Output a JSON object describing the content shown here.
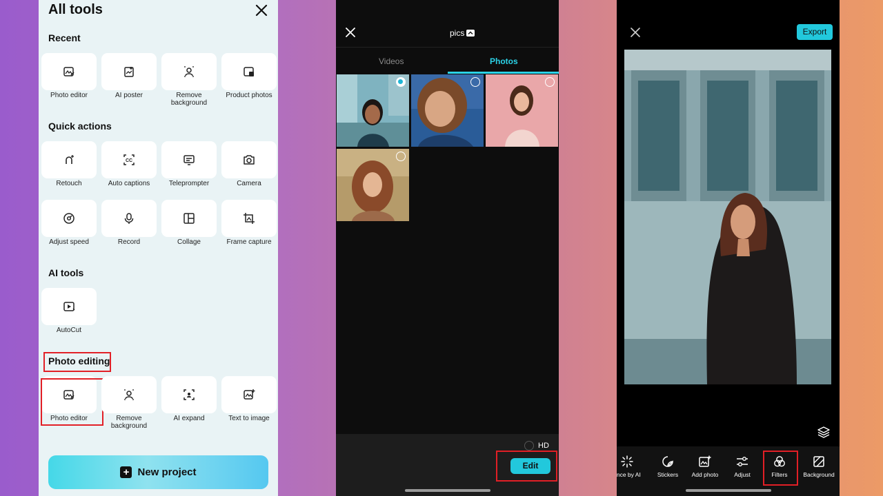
{
  "panel1": {
    "title": "All tools",
    "sections": {
      "recent": "Recent",
      "quick_actions": "Quick actions",
      "ai_tools": "AI tools",
      "photo_editing": "Photo editing"
    },
    "recent": [
      "Photo editor",
      "AI poster",
      "Remove background",
      "Product photos"
    ],
    "quick_actions_row1": [
      "Retouch",
      "Auto captions",
      "Teleprompter",
      "Camera"
    ],
    "quick_actions_row2": [
      "Adjust speed",
      "Record",
      "Collage",
      "Frame capture"
    ],
    "ai_tools": [
      "AutoCut"
    ],
    "photo_editing": [
      "Photo editor",
      "Remove background",
      "AI expand",
      "Text to image"
    ],
    "new_project": "New project"
  },
  "panel2": {
    "folder": "pics",
    "tabs": [
      "Videos",
      "Photos"
    ],
    "active_tab": "Photos",
    "hd_label": "HD",
    "edit_label": "Edit"
  },
  "panel3": {
    "export_label": "Export",
    "tools": [
      "ance by AI",
      "Stickers",
      "Add photo",
      "Adjust",
      "Filters",
      "Background"
    ]
  },
  "colors": {
    "accent": "#22c8dc",
    "highlight": "#e21f26",
    "panel1_bg": "#e9f3f5"
  }
}
